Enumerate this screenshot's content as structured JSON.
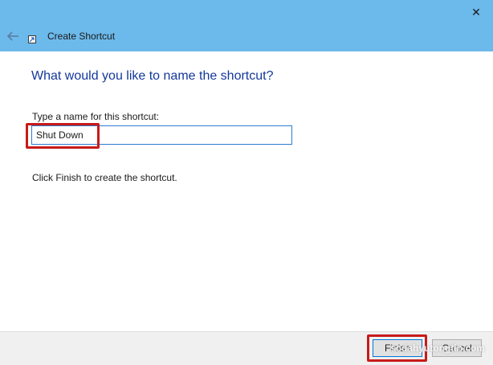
{
  "window": {
    "title": "Create Shortcut",
    "close_glyph": "✕"
  },
  "wizard": {
    "heading": "What would you like to name the shortcut?",
    "name_label": "Type a name for this shortcut:",
    "name_value": "Shut Down",
    "instruction": "Click Finish to create the shortcut."
  },
  "footer": {
    "finish_label": "Finish",
    "cancel_label": "Cancel",
    "watermark": "sodahyutongtin.com"
  },
  "colors": {
    "titlebar": "#6cb9eb",
    "heading": "#14389a",
    "highlight": "#c81a1a",
    "input_border": "#2e7bd1"
  },
  "icons": {
    "back": "back-arrow-icon",
    "app": "shortcut-icon",
    "close": "close-icon"
  }
}
